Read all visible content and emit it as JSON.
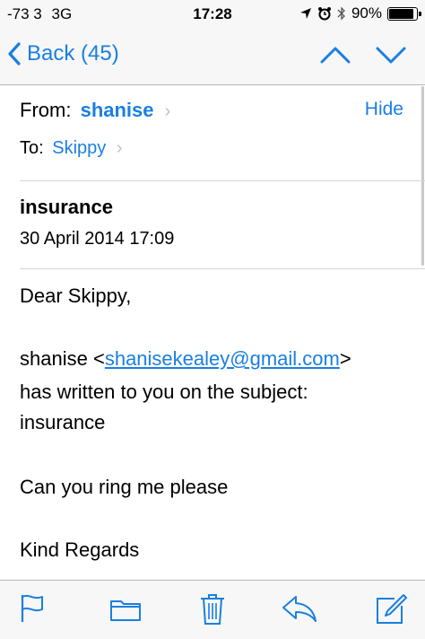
{
  "status_bar": {
    "carrier": "-73 3",
    "network": "3G",
    "time": "17:28",
    "battery_percent": "90%",
    "battery_level": 0.9,
    "icons": [
      "location-arrow-icon",
      "alarm-icon",
      "bluetooth-icon",
      "battery-icon"
    ]
  },
  "nav": {
    "back_label": "Back (45)",
    "icons": [
      "chevron-left-icon",
      "chevron-up-icon",
      "chevron-down-icon"
    ]
  },
  "header": {
    "from_label": "From:",
    "from_name": "shanise",
    "hide_label": "Hide",
    "to_label": "To:",
    "to_name": "Skippy",
    "chevron": "›"
  },
  "message": {
    "subject": "insurance",
    "date": "30 April 2014 17:09",
    "greeting": "Dear Skippy,",
    "sender_name": "shanise",
    "sender_email": "shanisekealey@gmail.com",
    "line_written": "has written to you on the subject:",
    "line_subject": "insurance",
    "line_request": "Can you ring me please",
    "closing": "Kind Regards"
  },
  "toolbar": {
    "icons": [
      "flag-icon",
      "folder-icon",
      "trash-icon",
      "reply-icon",
      "compose-icon"
    ]
  },
  "colors": {
    "accent": "#1a7fe0",
    "bar_background": "#f7f7f7",
    "separator": "#d4d4d8"
  }
}
